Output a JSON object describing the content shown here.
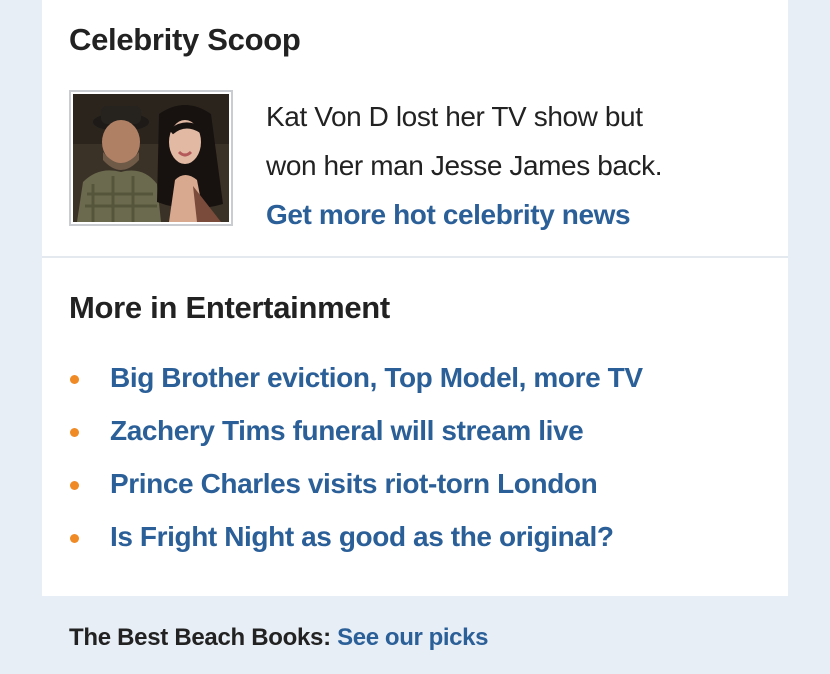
{
  "celebrity_scoop": {
    "title": "Celebrity Scoop",
    "blurb_line1": "Kat Von D lost her TV show but",
    "blurb_line2": "won her man Jesse James back.",
    "link": "Get more hot celebrity news"
  },
  "more_entertainment": {
    "title": "More in Entertainment",
    "items": [
      {
        "label": "Big Brother eviction, Top Model, more TV"
      },
      {
        "label": "Zachery Tims funeral will stream live"
      },
      {
        "label": "Prince Charles visits riot-torn London"
      },
      {
        "label": "Is Fright Night as good as the original?"
      }
    ]
  },
  "footer": {
    "label": "The Best Beach Books:",
    "link": "See our picks"
  },
  "colors": {
    "link": "#2b5f98",
    "bullet": "#f08a24",
    "background": "#e8eef5"
  }
}
